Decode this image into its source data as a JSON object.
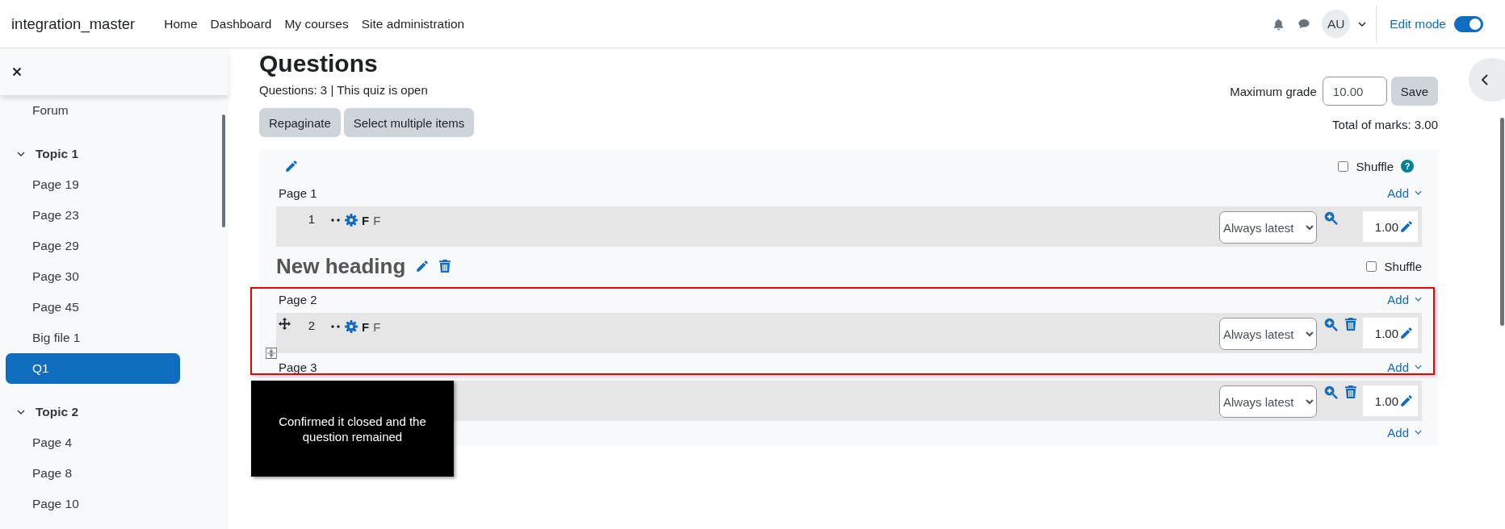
{
  "header": {
    "site_name": "integration_master",
    "nav": [
      {
        "label": "Home"
      },
      {
        "label": "Dashboard"
      },
      {
        "label": "My courses"
      },
      {
        "label": "Site administration"
      }
    ],
    "avatar": "AU",
    "edit_mode": {
      "label": "Edit mode",
      "on": true
    }
  },
  "sidebar": {
    "items": [
      {
        "kind": "activity",
        "label": "Forum",
        "selected": false
      },
      {
        "kind": "section",
        "label": "Topic 1",
        "expanded": true,
        "children": [
          {
            "label": "Page 19",
            "selected": false
          },
          {
            "label": "Page 23",
            "selected": false
          },
          {
            "label": "Page 29",
            "selected": false
          },
          {
            "label": "Page 30",
            "selected": false
          },
          {
            "label": "Page 45",
            "selected": false
          },
          {
            "label": "Big file 1",
            "selected": false
          },
          {
            "label": "Q1",
            "selected": true
          }
        ]
      },
      {
        "kind": "section",
        "label": "Topic 2",
        "expanded": true,
        "children": [
          {
            "label": "Page 4",
            "selected": false
          },
          {
            "label": "Page 8",
            "selected": false
          },
          {
            "label": "Page 10",
            "selected": false
          }
        ]
      }
    ]
  },
  "main": {
    "title": "Questions",
    "summary": "Questions: 3 | This quiz is open",
    "buttons": [
      {
        "label": "Repaginate"
      },
      {
        "label": "Select multiple items"
      }
    ],
    "max_grade": {
      "label": "Maximum grade",
      "value": "10.00",
      "button": "Save"
    },
    "total": "Total of marks: 3.00",
    "sections": [
      {
        "shuffle": {
          "label": "Shuffle",
          "checked": false,
          "help": "?"
        },
        "deletable": false,
        "pages": [
          {
            "label": "Page 1",
            "add": "Add",
            "join": false,
            "question": {
              "number": "1",
              "name": "F",
              "text": "F",
              "version": "Always latest",
              "deletable": false,
              "move_handle": false,
              "mark": "1.00"
            }
          }
        ]
      },
      {
        "heading": "New heading",
        "shuffle": {
          "label": "Shuffle",
          "checked": false
        },
        "deletable": true,
        "pages": [
          {
            "label": "Page 2",
            "add": "Add",
            "join": false,
            "question": {
              "number": "2",
              "name": "F",
              "text": "F",
              "version": "Always latest",
              "deletable": true,
              "move_handle": true,
              "mark": "1.00"
            }
          },
          {
            "label": "Page 3",
            "add": "Add",
            "join": true,
            "question": {
              "version": "Always latest",
              "deletable": true,
              "move_handle": false,
              "mark": "1.00"
            }
          }
        ]
      }
    ],
    "final_add": "Add"
  },
  "annotation": {
    "note": "Confirmed it closed and the question remained"
  }
}
